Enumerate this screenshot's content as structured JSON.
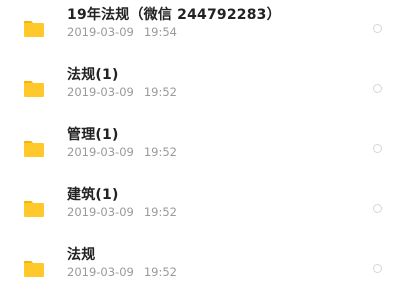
{
  "colors": {
    "folder": "#FFC92C",
    "folder_tab": "#F5B400",
    "name_text": "#222222",
    "time_text": "#9A9A9A",
    "radio_border": "#D6D6D6"
  },
  "files": [
    {
      "icon": "folder-icon",
      "name": "19年法规（微信 244792283）",
      "date": "2019-03-09",
      "time": "19:54",
      "selected": false
    },
    {
      "icon": "folder-icon",
      "name": "法规(1)",
      "date": "2019-03-09",
      "time": "19:52",
      "selected": false
    },
    {
      "icon": "folder-icon",
      "name": "管理(1)",
      "date": "2019-03-09",
      "time": "19:52",
      "selected": false
    },
    {
      "icon": "folder-icon",
      "name": "建筑(1)",
      "date": "2019-03-09",
      "time": "19:52",
      "selected": false
    },
    {
      "icon": "folder-icon",
      "name": "法规",
      "date": "2019-03-09",
      "time": "19:52",
      "selected": false
    }
  ]
}
